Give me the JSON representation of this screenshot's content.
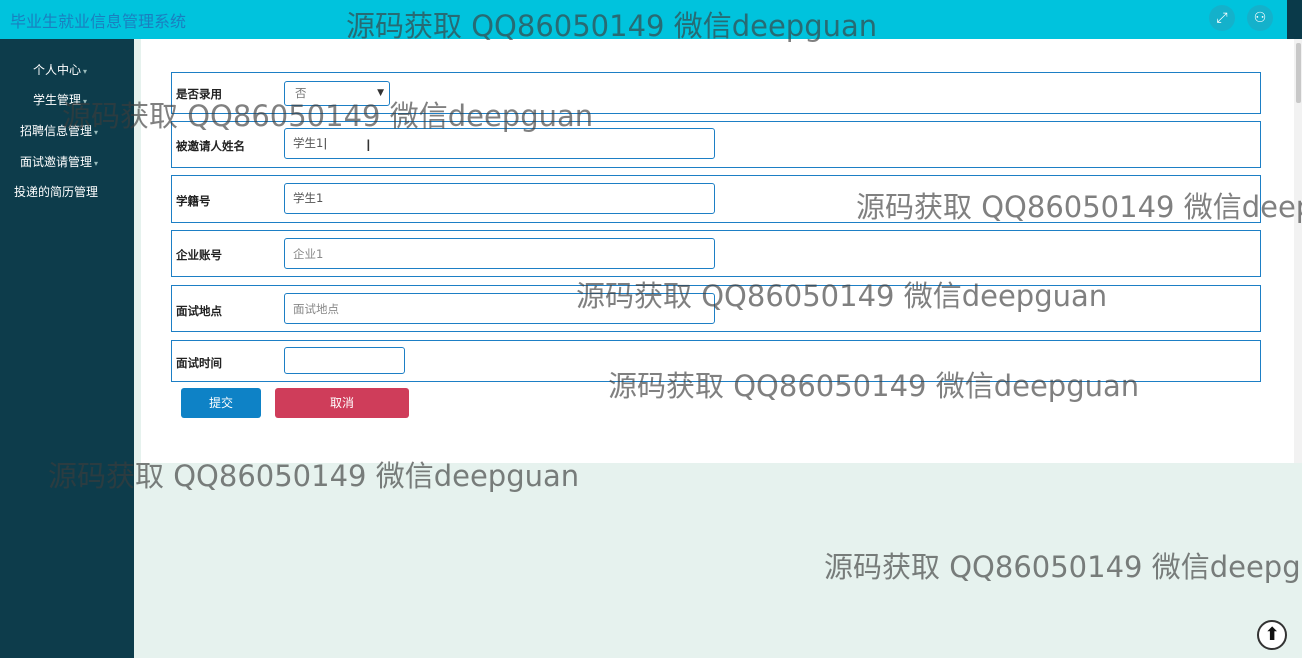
{
  "app": {
    "title": "毕业生就业信息管理系统"
  },
  "topbar": {
    "fullscreen_icon": "expand-icon",
    "user_icon": "user-icon"
  },
  "sidebar": {
    "items": [
      {
        "label": "个人中心",
        "has_caret": true
      },
      {
        "label": "学生管理",
        "has_caret": true
      },
      {
        "label": "招聘信息管理",
        "has_caret": true
      },
      {
        "label": "面试邀请管理",
        "has_caret": true
      },
      {
        "label": "投递的简历管理",
        "has_caret": false
      }
    ]
  },
  "form": {
    "hired": {
      "label": "是否录用",
      "value": "否"
    },
    "invitee_name": {
      "label": "被邀请人姓名",
      "value": "学生1"
    },
    "student_id": {
      "label": "学籍号",
      "value": "学生1"
    },
    "company_account": {
      "label": "企业账号",
      "placeholder": "企业1"
    },
    "location": {
      "label": "面试地点",
      "placeholder": "面试地点"
    },
    "time": {
      "label": "面试时间",
      "value": ""
    },
    "submit_label": "提交",
    "cancel_label": "取消"
  },
  "watermark": {
    "text": "源码获取 QQ86050149 微信deepguan"
  },
  "colors": {
    "topbar": "#00c3dd",
    "sidebar": "#0d3c4b",
    "border_accent": "#1d7fc5",
    "submit": "#0e82c6",
    "cancel": "#cf3d5a"
  }
}
